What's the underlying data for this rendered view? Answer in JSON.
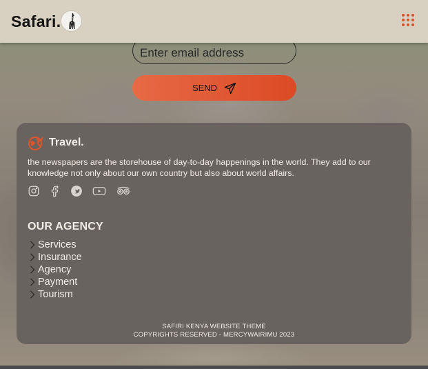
{
  "header": {
    "brand": "Safari.",
    "logo_icon": "giraffe-icon",
    "menu_icon": "grid-menu-icon",
    "accent_color": "#d8522a"
  },
  "subscribe": {
    "email_placeholder": "Enter email address",
    "send_label": "SEND",
    "send_icon": "paper-plane-icon"
  },
  "footer": {
    "brand": "Travel.",
    "brand_icon": "globe-plane-icon",
    "description": "the newspapers are the storehouse of day-to-day happenings in the world. They add to our knowledge not only about our own country but also about world affairs.",
    "social_icons": [
      "instagram-icon",
      "facebook-icon",
      "twitter-icon",
      "youtube-icon",
      "tripadvisor-icon"
    ],
    "agency_heading": "OUR AGENCY",
    "agency_links": [
      {
        "label": "Services"
      },
      {
        "label": "Insurance"
      },
      {
        "label": "Agency"
      },
      {
        "label": "Payment"
      },
      {
        "label": "Tourism"
      }
    ],
    "copyright_line1": "SAFIRI KENYA WEBSITE THEME",
    "copyright_line2": "COPYRIGHTS RESERVED - MERCYWAIRIMU 2023"
  }
}
